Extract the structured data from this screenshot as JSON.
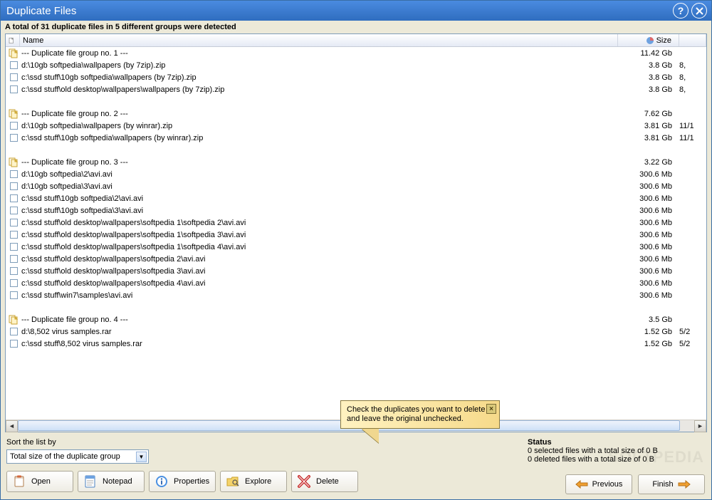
{
  "title": "Duplicate Files",
  "summary": "A total of 31 duplicate files in 5 different groups were detected",
  "columns": {
    "name": "Name",
    "size": "Size"
  },
  "rows": [
    {
      "type": "group",
      "name": "--- Duplicate file group no. 1 ---",
      "size": "11.42 Gb",
      "date": ""
    },
    {
      "type": "file",
      "name": "d:\\10gb softpedia\\wallpapers (by 7zip).zip",
      "size": "3.8 Gb",
      "date": "8,"
    },
    {
      "type": "file",
      "name": "c:\\ssd stuff\\10gb softpedia\\wallpapers (by 7zip).zip",
      "size": "3.8 Gb",
      "date": "8,"
    },
    {
      "type": "file",
      "name": "c:\\ssd stuff\\old desktop\\wallpapers\\wallpapers (by 7zip).zip",
      "size": "3.8 Gb",
      "date": "8,"
    },
    {
      "type": "spacer"
    },
    {
      "type": "group",
      "name": "--- Duplicate file group no. 2 ---",
      "size": "7.62 Gb",
      "date": ""
    },
    {
      "type": "file",
      "name": "d:\\10gb softpedia\\wallpapers (by winrar).zip",
      "size": "3.81 Gb",
      "date": "11/1"
    },
    {
      "type": "file",
      "name": "c:\\ssd stuff\\10gb softpedia\\wallpapers (by winrar).zip",
      "size": "3.81 Gb",
      "date": "11/1"
    },
    {
      "type": "spacer"
    },
    {
      "type": "group",
      "name": "--- Duplicate file group no. 3 ---",
      "size": "3.22 Gb",
      "date": ""
    },
    {
      "type": "file",
      "name": "d:\\10gb softpedia\\2\\avi.avi",
      "size": "300.6 Mb",
      "date": ""
    },
    {
      "type": "file",
      "name": "d:\\10gb softpedia\\3\\avi.avi",
      "size": "300.6 Mb",
      "date": ""
    },
    {
      "type": "file",
      "name": "c:\\ssd stuff\\10gb softpedia\\2\\avi.avi",
      "size": "300.6 Mb",
      "date": ""
    },
    {
      "type": "file",
      "name": "c:\\ssd stuff\\10gb softpedia\\3\\avi.avi",
      "size": "300.6 Mb",
      "date": ""
    },
    {
      "type": "file",
      "name": "c:\\ssd stuff\\old desktop\\wallpapers\\softpedia 1\\softpedia 2\\avi.avi",
      "size": "300.6 Mb",
      "date": ""
    },
    {
      "type": "file",
      "name": "c:\\ssd stuff\\old desktop\\wallpapers\\softpedia 1\\softpedia 3\\avi.avi",
      "size": "300.6 Mb",
      "date": ""
    },
    {
      "type": "file",
      "name": "c:\\ssd stuff\\old desktop\\wallpapers\\softpedia 1\\softpedia 4\\avi.avi",
      "size": "300.6 Mb",
      "date": ""
    },
    {
      "type": "file",
      "name": "c:\\ssd stuff\\old desktop\\wallpapers\\softpedia 2\\avi.avi",
      "size": "300.6 Mb",
      "date": ""
    },
    {
      "type": "file",
      "name": "c:\\ssd stuff\\old desktop\\wallpapers\\softpedia 3\\avi.avi",
      "size": "300.6 Mb",
      "date": ""
    },
    {
      "type": "file",
      "name": "c:\\ssd stuff\\old desktop\\wallpapers\\softpedia 4\\avi.avi",
      "size": "300.6 Mb",
      "date": ""
    },
    {
      "type": "file",
      "name": "c:\\ssd stuff\\win7\\samples\\avi.avi",
      "size": "300.6 Mb",
      "date": ""
    },
    {
      "type": "spacer"
    },
    {
      "type": "group",
      "name": "--- Duplicate file group no. 4 ---",
      "size": "3.5 Gb",
      "date": ""
    },
    {
      "type": "file",
      "name": "d:\\8,502 virus samples.rar",
      "size": "1.52 Gb",
      "date": "5/2"
    },
    {
      "type": "file",
      "name": "c:\\ssd stuff\\8,502 virus samples.rar",
      "size": "1.52 Gb",
      "date": "5/2"
    }
  ],
  "sort": {
    "label": "Sort the list by",
    "value": "Total size of the duplicate group"
  },
  "status": {
    "title": "Status",
    "line1": "0 selected files with a total size of 0 B",
    "line2": "0 deleted files with a total size of 0 B"
  },
  "buttons": {
    "open": "Open",
    "notepad": "Notepad",
    "properties": "Properties",
    "explore": "Explore",
    "delete": "Delete"
  },
  "wizard": {
    "previous": "Previous",
    "finish": "Finish"
  },
  "tooltip": "Check the duplicates you want to delete and leave the original unchecked.",
  "watermark": "SOFTPEDIA"
}
